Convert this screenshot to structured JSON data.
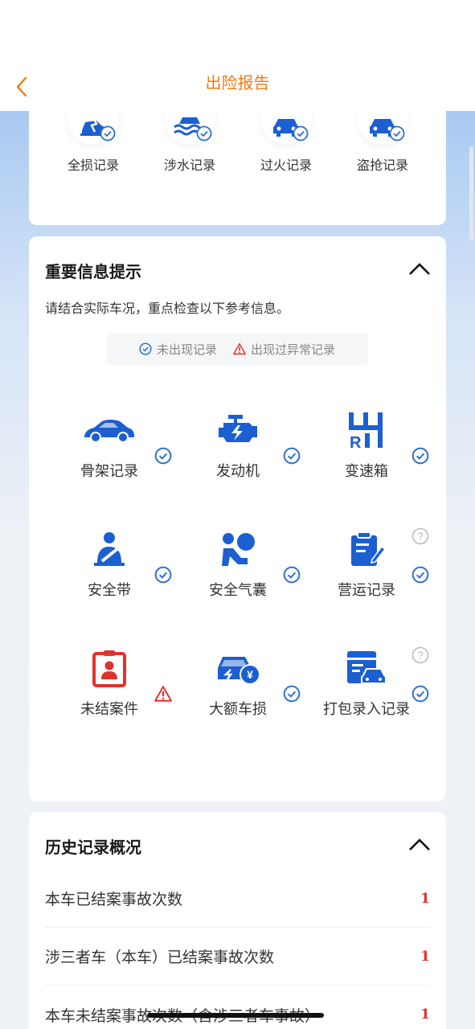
{
  "header": {
    "title": "出险报告"
  },
  "top_records": [
    {
      "label": "全损记录",
      "icon": "car-crash-icon"
    },
    {
      "label": "涉水记录",
      "icon": "car-flood-icon"
    },
    {
      "label": "过火记录",
      "icon": "car-fire-icon"
    },
    {
      "label": "盗抢记录",
      "icon": "car-theft-icon"
    }
  ],
  "important_info": {
    "title": "重要信息提示",
    "subtitle": "请结合实际车况，重点检查以下参考信息。",
    "legend_ok": "未出现记录",
    "legend_warn": "出现过异常记录",
    "items": [
      {
        "label": "骨架记录",
        "icon": "car-frame-icon",
        "status": "ok"
      },
      {
        "label": "发动机",
        "icon": "engine-icon",
        "status": "ok"
      },
      {
        "label": "变速箱",
        "icon": "gearbox-icon",
        "status": "ok"
      },
      {
        "label": "安全带",
        "icon": "seatbelt-icon",
        "status": "ok"
      },
      {
        "label": "安全气囊",
        "icon": "airbag-icon",
        "status": "ok"
      },
      {
        "label": "营运记录",
        "icon": "operation-record-icon",
        "status": "ok",
        "help": true
      },
      {
        "label": "未结案件",
        "icon": "open-case-icon",
        "status": "warn"
      },
      {
        "label": "大额车损",
        "icon": "large-damage-icon",
        "status": "ok"
      },
      {
        "label": "打包录入记录",
        "icon": "batch-entry-icon",
        "status": "ok",
        "help": true
      }
    ]
  },
  "history": {
    "title": "历史记录概况",
    "rows": [
      {
        "label": "本车已结案事故次数",
        "value": "1"
      },
      {
        "label": "涉三者车（本车）已结案事故次数",
        "value": "1"
      },
      {
        "label": "本车未结案事故次数（含涉三者车事故）",
        "value": "1"
      }
    ]
  },
  "colors": {
    "accent": "#f07a12",
    "icon_blue": "#1b5fd1",
    "warn_red": "#e0322b",
    "check_blue": "#2f6fd0"
  }
}
